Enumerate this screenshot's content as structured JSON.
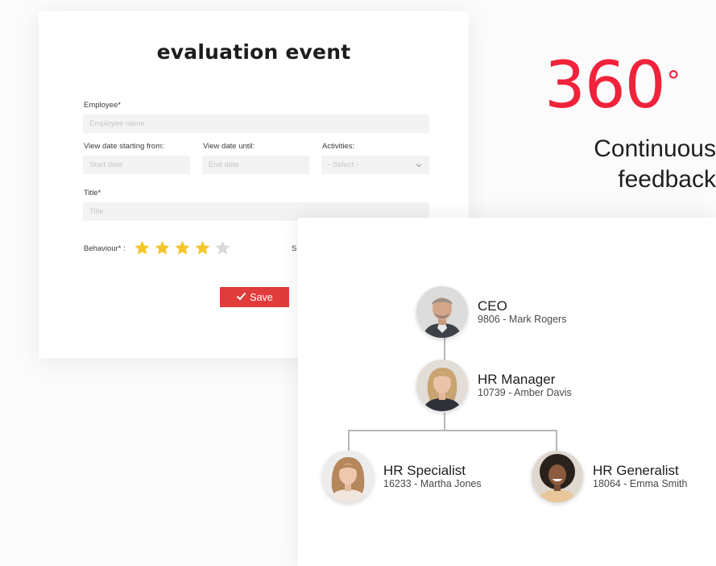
{
  "form": {
    "title": "evaluation event",
    "employee": {
      "label": "Employee*",
      "placeholder": "Employee name"
    },
    "start_date": {
      "label": "View date starting from:",
      "placeholder": "Start date"
    },
    "end_date": {
      "label": "View date until:",
      "placeholder": "End date"
    },
    "activities": {
      "label": "Activities:",
      "value": "- Select -"
    },
    "title_field": {
      "label": "Title*",
      "placeholder": "Title"
    },
    "behaviour": {
      "label": "Behaviour* :",
      "rating": 4,
      "max": 5
    },
    "partial_label": "S",
    "save_label": "Save"
  },
  "hero": {
    "number": "360",
    "degree": "°",
    "line1": "Continuous",
    "line2": "feedback"
  },
  "org_chart": {
    "nodes": [
      {
        "role": "CEO",
        "person": "9806 - Mark Rogers"
      },
      {
        "role": "HR Manager",
        "person": "10739 - Amber Davis"
      },
      {
        "role": "HR Specialist",
        "person": "16233 - Martha Jones"
      },
      {
        "role": "HR Generalist",
        "person": "18064 - Emma Smith"
      }
    ]
  },
  "colors": {
    "accent": "#f1223b",
    "button": "#e03c3c",
    "star_filled": "#f5c52c",
    "star_empty": "#d9d9d9"
  },
  "icons": {
    "save": "check-icon",
    "select": "chevron-down-icon",
    "rating": "star-icon"
  }
}
